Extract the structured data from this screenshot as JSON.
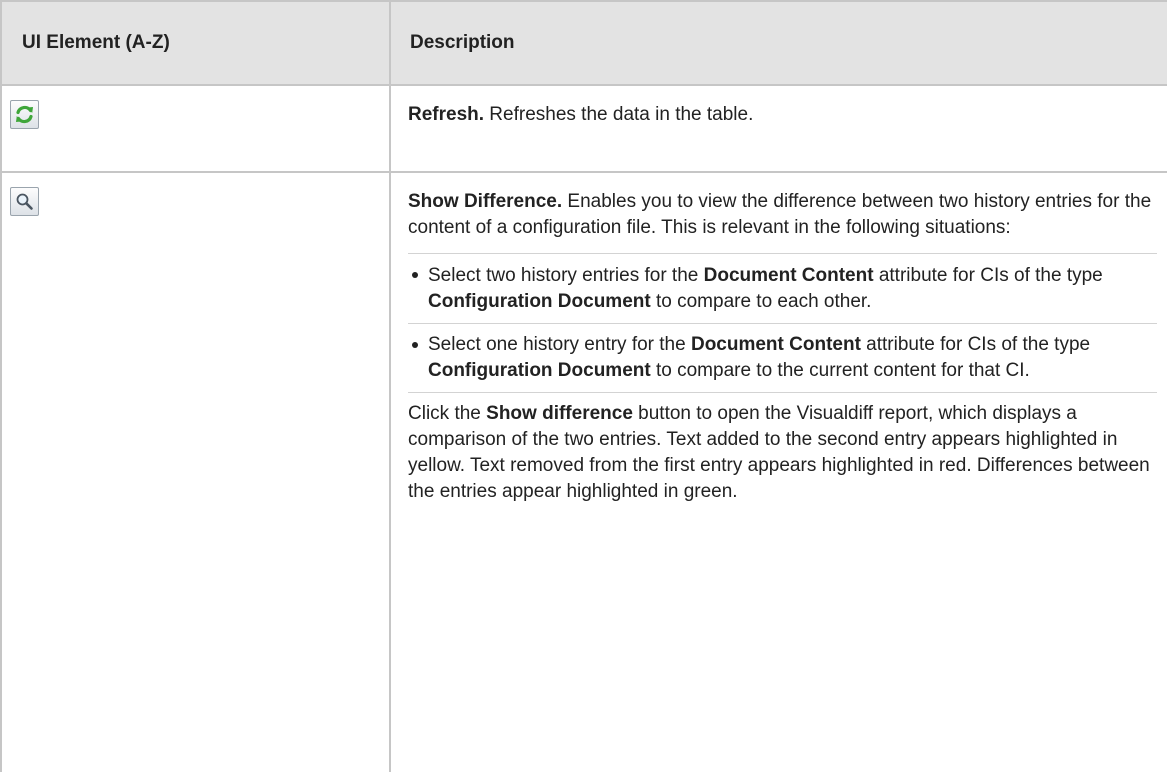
{
  "table": {
    "headers": [
      "UI Element (A-Z)",
      "Description"
    ],
    "rows": [
      {
        "icon": "refresh-icon",
        "title": "Refresh.",
        "text": " Refreshes the data in the table."
      },
      {
        "icon": "magnifier-icon",
        "title": "Show Difference.",
        "text": " Enables you to view the difference between two history entries for the content of a configuration file. This is relevant in the following situations:",
        "bullets": [
          {
            "t1": "Select two history entries for the ",
            "b1": "Document Content",
            "t2": " attribute for CIs of the type ",
            "b2": "Configuration Document",
            "t3": " to compare to each other."
          },
          {
            "t1": "Select one history entry for the ",
            "b1": "Document Content",
            "t2": " attribute for CIs of the type ",
            "b2": "Configuration Document",
            "t3": " to compare to the current content for that CI."
          }
        ],
        "click_prefix": "Click the ",
        "click_bold": "Show difference",
        "click_suffix": " button to open the Visualdiff report, which displays a comparison of the two entries. Text added to the second entry appears highlighted in yellow. Text removed from the first entry appears highlighted in red. Differences between the entries appear highlighted in green."
      }
    ]
  },
  "colors": {
    "header_bg": "#e3e3e3",
    "border": "#c6c6c6",
    "refresh_green": "#3fa63a",
    "text": "#222222"
  }
}
